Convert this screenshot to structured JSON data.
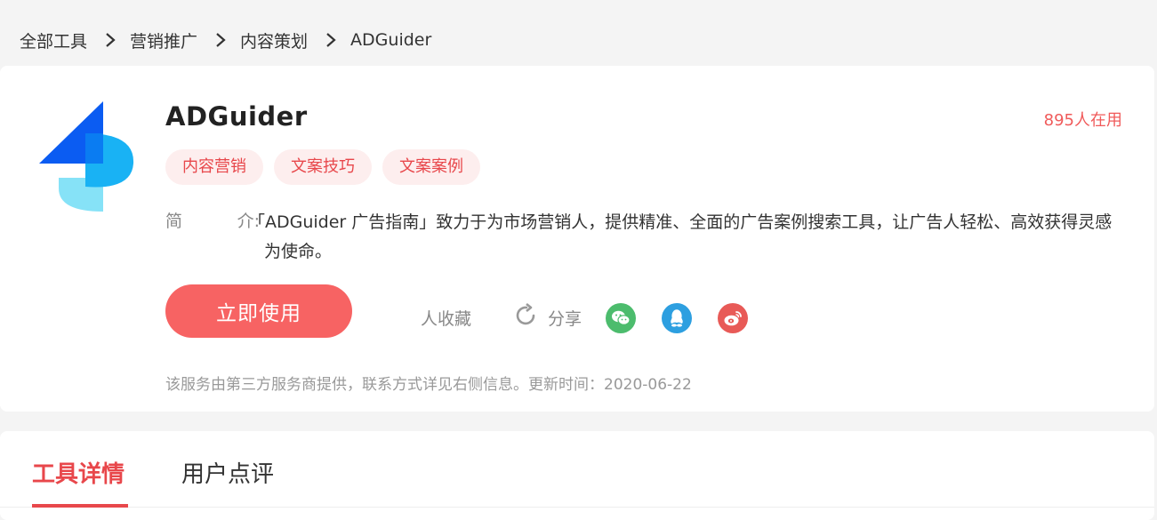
{
  "breadcrumb": {
    "items": [
      "全部工具",
      "营销推广",
      "内容策划",
      "ADGuider"
    ]
  },
  "tool": {
    "name": "ADGuider",
    "users": "895人在用",
    "tags": [
      "内容营销",
      "文案技巧",
      "文案案例"
    ],
    "intro_label_1": "简",
    "intro_label_2": "介:",
    "intro_text": "「ADGuider 广告指南」致力于为市场营销人，提供精准、全面的广告案例搜索工具，让广告人轻松、高效获得灵感为使命。",
    "use_button": "立即使用",
    "collect": "人收藏",
    "share": "分享",
    "notice": "该服务由第三方服务商提供，联系方式详见右侧信息。更新时间：2020-06-22"
  },
  "social": {
    "wechat_color": "#4cbc6d",
    "qq_color": "#2d9fe0",
    "weibo_color": "#e85a57"
  },
  "tabs": [
    "工具详情",
    "用户点评"
  ],
  "colors": {
    "accent": "#e8474b",
    "button": "#f76363"
  }
}
